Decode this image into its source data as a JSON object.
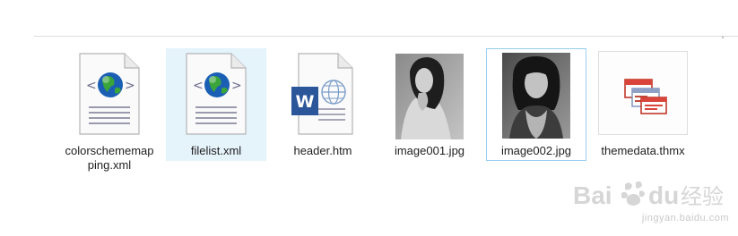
{
  "files": [
    {
      "name": "colorschememapping.xml",
      "type": "xml",
      "icon": "xml-globe-document-icon"
    },
    {
      "name": "filelist.xml",
      "type": "xml",
      "icon": "xml-globe-document-icon",
      "state": "hover"
    },
    {
      "name": "header.htm",
      "type": "htm",
      "icon": "word-html-document-icon"
    },
    {
      "name": "image001.jpg",
      "type": "jpg",
      "icon": "photo-thumbnail-icon"
    },
    {
      "name": "image002.jpg",
      "type": "jpg",
      "icon": "photo-thumbnail-icon",
      "state": "selected"
    },
    {
      "name": "themedata.thmx",
      "type": "thmx",
      "icon": "theme-document-icon"
    }
  ],
  "watermark": {
    "brand": "Bai du 经验",
    "url": "jingyan.baidu.com"
  },
  "colors": {
    "hover_bg": "#e5f3fb",
    "selected_border": "#99cdf0",
    "word_blue": "#2b579a",
    "globe_blue": "#1b5fb5",
    "globe_green": "#3aa53a"
  }
}
